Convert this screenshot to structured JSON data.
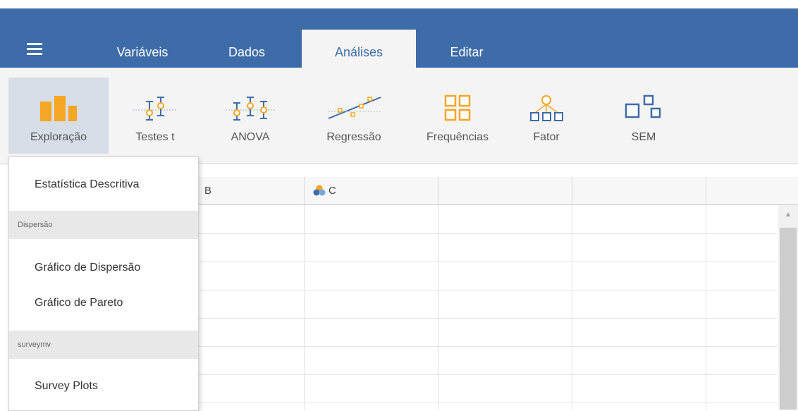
{
  "menubar": {
    "tabs": [
      {
        "label": "Variáveis",
        "active": false
      },
      {
        "label": "Dados",
        "active": false
      },
      {
        "label": "Análises",
        "active": true
      },
      {
        "label": "Editar",
        "active": false
      }
    ]
  },
  "ribbon": {
    "buttons": [
      {
        "label": "Exploração",
        "icon": "exploration-icon",
        "active": true
      },
      {
        "label": "Testes t",
        "icon": "t-tests-icon"
      },
      {
        "label": "ANOVA",
        "icon": "anova-icon"
      },
      {
        "label": "Regressão",
        "icon": "regression-icon"
      },
      {
        "label": "Frequências",
        "icon": "frequencies-icon"
      },
      {
        "label": "Fator",
        "icon": "factor-icon"
      },
      {
        "label": "SEM",
        "icon": "sem-icon"
      }
    ]
  },
  "grid": {
    "columns": [
      {
        "name": "B",
        "icon": null
      },
      {
        "name": "C",
        "icon": "nominal-variable-icon"
      }
    ]
  },
  "dropdown": {
    "items": {
      "descriptives": "Estatística Descritiva",
      "section_dispersion": "Dispersão",
      "scatterplot": "Gráfico de Dispersão",
      "pareto": "Gráfico de Pareto",
      "section_surveymv": "surveymv",
      "survey_plots": "Survey Plots"
    }
  },
  "colors": {
    "menubar": "#3e6ca8",
    "ribbon_bg": "#f4f4f4",
    "icon_orange": "#f5a623",
    "icon_blue": "#3e6ca8"
  }
}
